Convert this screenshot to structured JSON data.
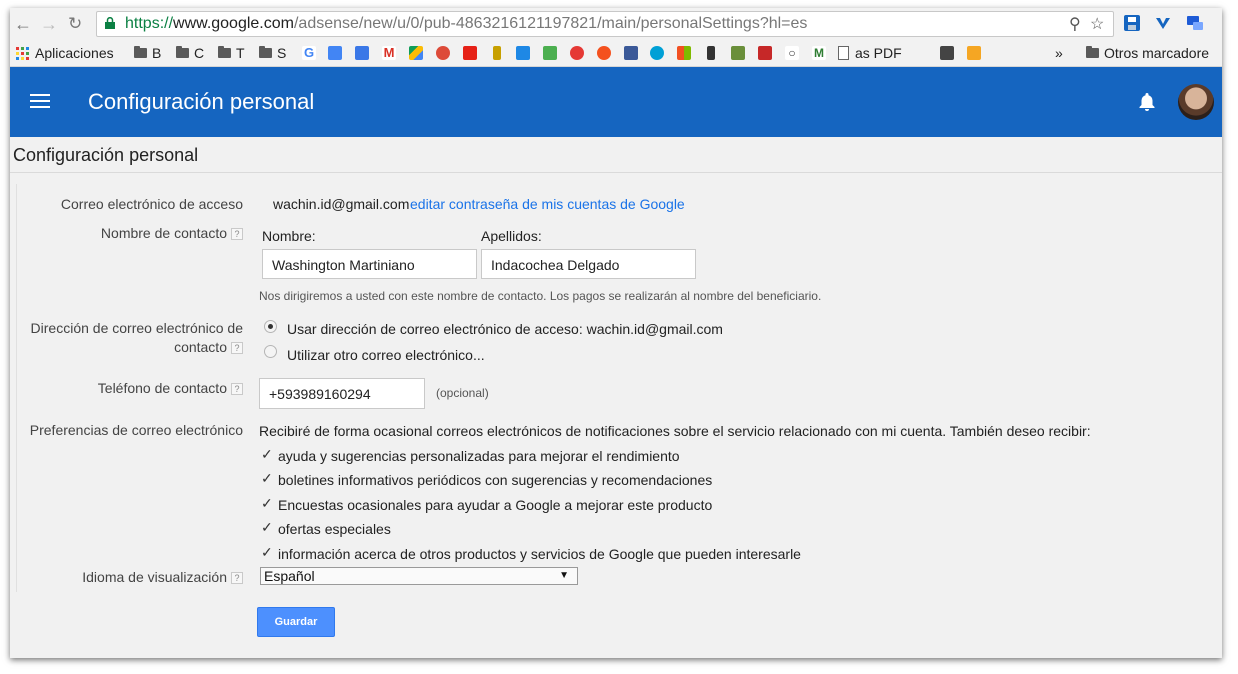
{
  "browser": {
    "url_scheme": "https://",
    "url_host": "www.google.com",
    "url_path": "/adsense/new/u/0/pub-4863216121197821/main/personalSettings?hl=es",
    "bookmarks": {
      "apps_label": "Aplicaciones",
      "folders": [
        "B",
        "C",
        "T",
        "S"
      ],
      "pdf_label": "as PDF",
      "more_label": "»",
      "other_label": "Otros marcadore"
    }
  },
  "appbar": {
    "title": "Configuración personal"
  },
  "page": {
    "heading": "Configuración personal",
    "login_email": {
      "label": "Correo electrónico de acceso",
      "value": "wachin.id@gmail.com",
      "link": "editar contraseña de mis cuentas de Google"
    },
    "contact_name": {
      "label": "Nombre de contacto",
      "first_label": "Nombre:",
      "first_value": "Washington Martiniano",
      "last_label": "Apellidos:",
      "last_value": "Indacochea Delgado",
      "note": "Nos dirigiremos a usted con este nombre de contacto. Los pagos se realizarán al nombre del beneficiario."
    },
    "contact_email": {
      "label_line1": "Dirección de correo electrónico de",
      "label_line2": "contacto",
      "option1": "Usar dirección de correo electrónico de acceso: wachin.id@gmail.com",
      "option2": "Utilizar otro correo electrónico..."
    },
    "phone": {
      "label": "Teléfono de contacto",
      "value": "+593989160294",
      "optional": "(opcional)"
    },
    "email_prefs": {
      "label": "Preferencias de correo electrónico",
      "intro": "Recibiré de forma ocasional correos electrónicos de notificaciones sobre el servicio relacionado con mi cuenta. También deseo recibir:",
      "options": [
        "ayuda y sugerencias personalizadas para mejorar el rendimiento",
        "boletines informativos periódicos con sugerencias y recomendaciones",
        "Encuestas ocasionales para ayudar a Google a mejorar este producto",
        "ofertas especiales",
        "información acerca de otros productos y servicios de Google que pueden interesarle"
      ]
    },
    "language": {
      "label": "Idioma de visualización",
      "value": "Español"
    },
    "help_glyph": "?",
    "check_glyph": "✓",
    "select_arrow": "▼",
    "save_button": "Guardar"
  },
  "colors": {
    "appbar": "#1565c0",
    "link": "#1a73e8",
    "button": "#4d90fe"
  }
}
